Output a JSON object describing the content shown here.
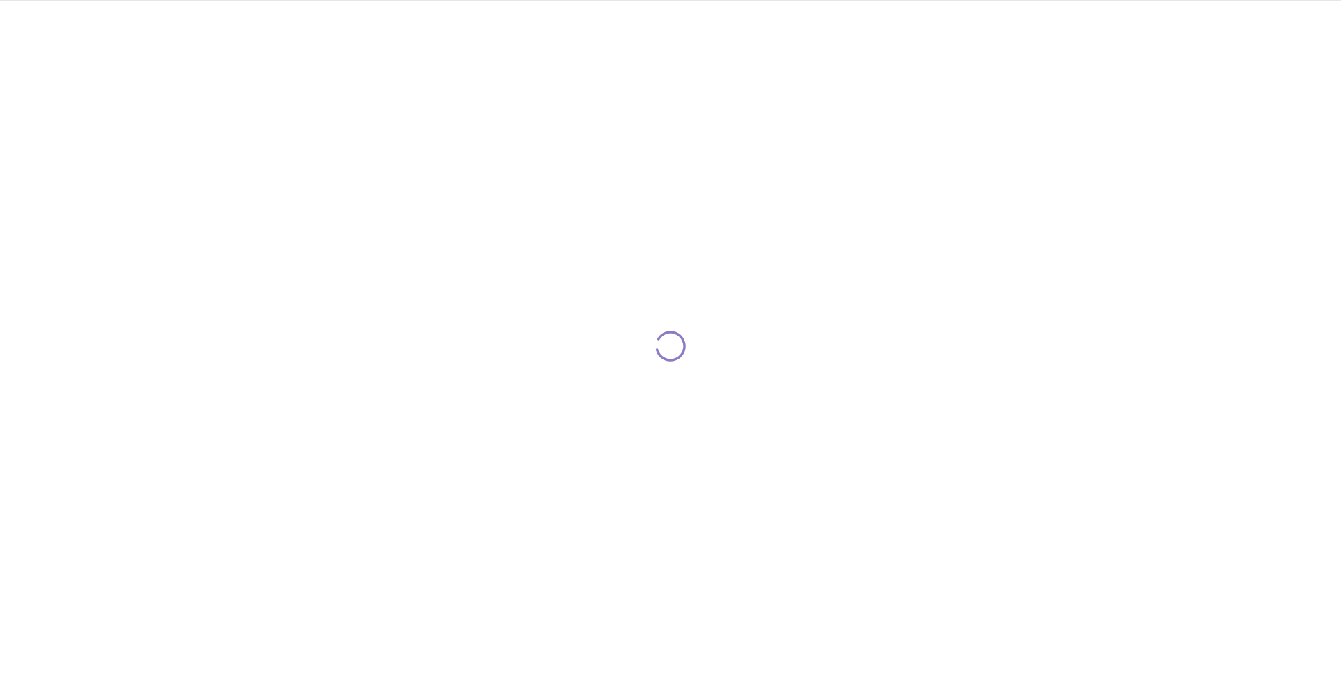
{
  "loading": {
    "accent_color": "#8e7cc3",
    "icon": "loading-spinner-icon"
  }
}
